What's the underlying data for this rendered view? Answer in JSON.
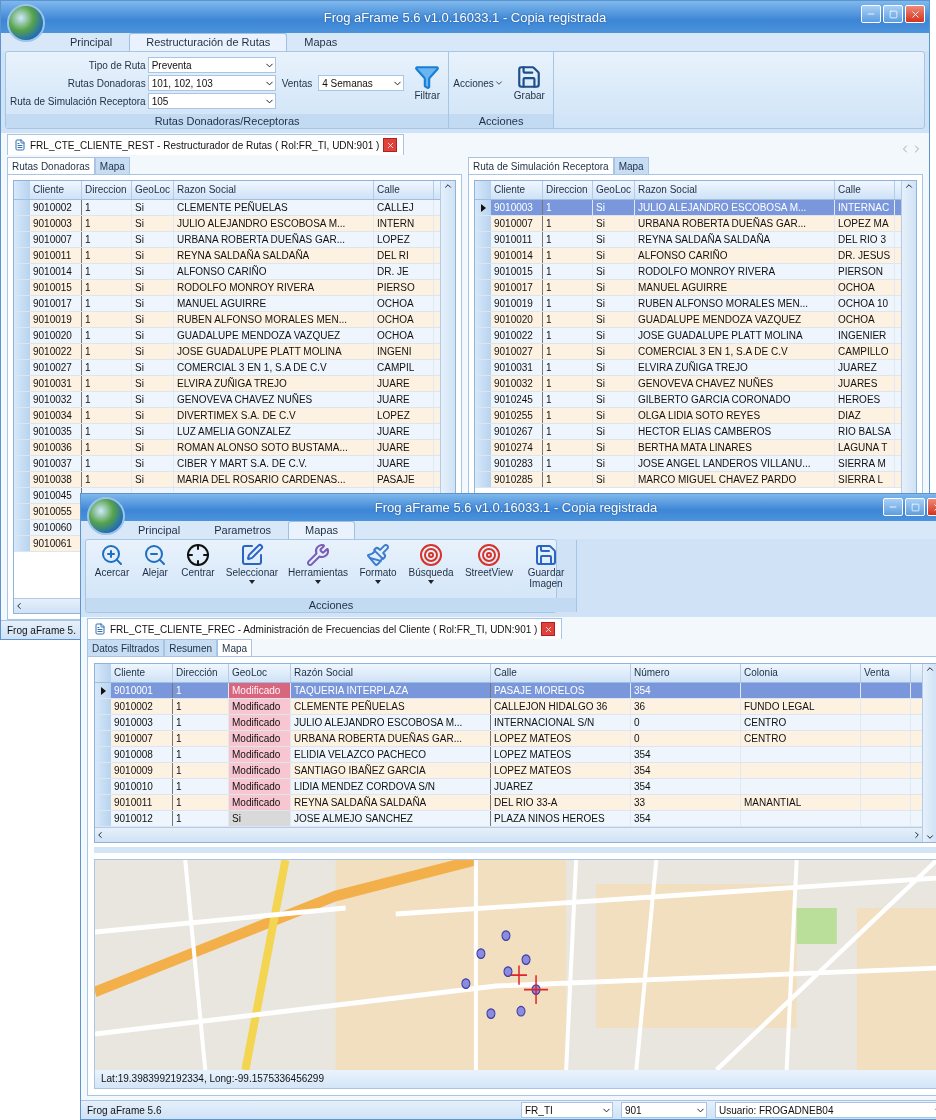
{
  "main_window": {
    "title": "Frog aFrame 5.6 v1.0.16033.1 - Copia registrada",
    "ribbon_tabs": [
      {
        "label": "Principal",
        "selected": false
      },
      {
        "label": "Restructuración de Rutas",
        "selected": true
      },
      {
        "label": "Mapas",
        "selected": false
      }
    ],
    "route_fields": [
      {
        "label": "Tipo de Ruta",
        "value": "Preventa"
      },
      {
        "label": "Rutas Donadoras",
        "value": "101, 102, 103"
      },
      {
        "label": "Ruta de Simulación Receptora",
        "value": "105"
      }
    ],
    "ventas": {
      "label": "Ventas",
      "value": "4 Semanas"
    },
    "filter_button": "Filtrar",
    "group_label": "Rutas Donadoras/Receptoras",
    "actions_menu": "Acciones",
    "save_button": "Grabar",
    "actions_group_label": "Acciones",
    "document_tab": "FRL_CTE_CLIENTE_REST - Restructurador de Rutas ( Rol:FR_TI, UDN:901 )",
    "panels": [
      {
        "tabs": [
          {
            "label": "Rutas Donadoras",
            "selected": true
          },
          {
            "label": "Mapa",
            "selected": false
          }
        ],
        "columns": [
          "Cliente",
          "Direccion",
          "GeoLoc",
          "Razon Social",
          "Calle"
        ],
        "rows": [
          {
            "cells": [
              "9010002",
              "1",
              "Si",
              "CLEMENTE PEÑUELAS",
              "CALLEJ"
            ],
            "selected": false
          },
          {
            "cells": [
              "9010003",
              "1",
              "Si",
              "JULIO ALEJANDRO ESCOBOSA M...",
              "INTERN"
            ],
            "selected": false
          },
          {
            "cells": [
              "9010007",
              "1",
              "Si",
              "URBANA ROBERTA DUEÑAS GAR...",
              "LOPEZ"
            ],
            "selected": false
          },
          {
            "cells": [
              "9010011",
              "1",
              "Si",
              "REYNA SALDAÑA SALDAÑA",
              "DEL RI"
            ],
            "selected": false
          },
          {
            "cells": [
              "9010014",
              "1",
              "Si",
              "ALFONSO CARIÑO",
              "DR. JE"
            ],
            "selected": false
          },
          {
            "cells": [
              "9010015",
              "1",
              "Si",
              "RODOLFO MONROY RIVERA",
              "PIERSO"
            ],
            "selected": false
          },
          {
            "cells": [
              "9010017",
              "1",
              "Si",
              "MANUEL AGUIRRE",
              "OCHOA"
            ],
            "selected": false
          },
          {
            "cells": [
              "9010019",
              "1",
              "Si",
              "RUBEN ALFONSO MORALES MEN...",
              "OCHOA"
            ],
            "selected": false
          },
          {
            "cells": [
              "9010020",
              "1",
              "Si",
              "GUADALUPE MENDOZA VAZQUEZ",
              "OCHOA"
            ],
            "selected": false
          },
          {
            "cells": [
              "9010022",
              "1",
              "Si",
              "JOSE GUADALUPE PLATT MOLINA",
              "INGENI"
            ],
            "selected": false
          },
          {
            "cells": [
              "9010027",
              "1",
              "Si",
              "COMERCIAL 3 EN 1, S.A DE C.V",
              "CAMPIL"
            ],
            "selected": false
          },
          {
            "cells": [
              "9010031",
              "1",
              "Si",
              "ELVIRA ZUÑIGA TREJO",
              "JUARE"
            ],
            "selected": false
          },
          {
            "cells": [
              "9010032",
              "1",
              "Si",
              "GENOVEVA CHAVEZ NUÑES",
              "JUARE"
            ],
            "selected": false
          },
          {
            "cells": [
              "9010034",
              "1",
              "Si",
              "DIVERTIMEX S.A. DE C.V",
              "LOPEZ"
            ],
            "selected": false
          },
          {
            "cells": [
              "9010035",
              "1",
              "Si",
              "LUZ AMELIA GONZALEZ",
              "JUARE"
            ],
            "selected": false
          },
          {
            "cells": [
              "9010036",
              "1",
              "Si",
              "ROMAN ALONSO SOTO BUSTAMA...",
              "JUARE"
            ],
            "selected": false
          },
          {
            "cells": [
              "9010037",
              "1",
              "Si",
              "CIBER Y MART S.A. DE C.V.",
              "JUARE"
            ],
            "selected": false
          },
          {
            "cells": [
              "9010038",
              "1",
              "Si",
              "MARIA DEL ROSARIO CARDENAS...",
              "PASAJE"
            ],
            "selected": false
          },
          {
            "cells": [
              "9010045"
            ],
            "selected": false
          },
          {
            "cells": [
              "9010055"
            ],
            "selected": false
          },
          {
            "cells": [
              "9010060"
            ],
            "selected": false
          },
          {
            "cells": [
              "9010061"
            ],
            "selected": false
          }
        ]
      },
      {
        "tabs": [
          {
            "label": "Ruta de Simulación Receptora",
            "selected": true
          },
          {
            "label": "Mapa",
            "selected": false
          }
        ],
        "columns": [
          "Cliente",
          "Direccion",
          "GeoLoc",
          "Razon Social",
          "Calle"
        ],
        "rows": [
          {
            "cells": [
              "9010003",
              "1",
              "Si",
              "JULIO ALEJANDRO ESCOBOSA M...",
              "INTERNAC"
            ],
            "selected": true
          },
          {
            "cells": [
              "9010007",
              "1",
              "Si",
              "URBANA ROBERTA DUEÑAS GAR...",
              "LOPEZ MA"
            ],
            "selected": false
          },
          {
            "cells": [
              "9010011",
              "1",
              "Si",
              "REYNA SALDAÑA SALDAÑA",
              "DEL RIO 3"
            ],
            "selected": false
          },
          {
            "cells": [
              "9010014",
              "1",
              "Si",
              "ALFONSO CARIÑO",
              "DR. JESUS"
            ],
            "selected": false
          },
          {
            "cells": [
              "9010015",
              "1",
              "Si",
              "RODOLFO MONROY RIVERA",
              "PIERSON"
            ],
            "selected": false
          },
          {
            "cells": [
              "9010017",
              "1",
              "Si",
              "MANUEL AGUIRRE",
              "OCHOA"
            ],
            "selected": false
          },
          {
            "cells": [
              "9010019",
              "1",
              "Si",
              "RUBEN ALFONSO MORALES MEN...",
              "OCHOA 10"
            ],
            "selected": false
          },
          {
            "cells": [
              "9010020",
              "1",
              "Si",
              "GUADALUPE MENDOZA VAZQUEZ",
              "OCHOA"
            ],
            "selected": false
          },
          {
            "cells": [
              "9010022",
              "1",
              "Si",
              "JOSE GUADALUPE PLATT MOLINA",
              "INGENIER"
            ],
            "selected": false
          },
          {
            "cells": [
              "9010027",
              "1",
              "Si",
              "COMERCIAL 3 EN 1, S.A DE C.V",
              "CAMPILLO"
            ],
            "selected": false
          },
          {
            "cells": [
              "9010031",
              "1",
              "Si",
              "ELVIRA ZUÑIGA TREJO",
              "JUAREZ"
            ],
            "selected": false
          },
          {
            "cells": [
              "9010032",
              "1",
              "Si",
              "GENOVEVA CHAVEZ NUÑES",
              "JUARES"
            ],
            "selected": false
          },
          {
            "cells": [
              "9010245",
              "1",
              "Si",
              "GILBERTO GARCIA CORONADO",
              "HEROES"
            ],
            "selected": false
          },
          {
            "cells": [
              "9010255",
              "1",
              "Si",
              "OLGA LIDIA SOTO REYES",
              "DIAZ"
            ],
            "selected": false
          },
          {
            "cells": [
              "9010267",
              "1",
              "Si",
              "HECTOR ELIAS CAMBEROS",
              "RIO BALSA"
            ],
            "selected": false
          },
          {
            "cells": [
              "9010274",
              "1",
              "Si",
              "BERTHA MATA LINARES",
              "LAGUNA T"
            ],
            "selected": false
          },
          {
            "cells": [
              "9010283",
              "1",
              "Si",
              "JOSE ANGEL LANDEROS VILLANU...",
              "SIERRA M"
            ],
            "selected": false
          },
          {
            "cells": [
              "9010285",
              "1",
              "Si",
              "MARCO MIGUEL CHAVEZ PARDO",
              "SIERRA L"
            ],
            "selected": false
          }
        ]
      }
    ],
    "status_bar": "Frog aFrame 5."
  },
  "map_window": {
    "title": "Frog aFrame 5.6 v1.0.16033.1 - Copia registrada",
    "ribbon_tabs": [
      {
        "label": "Principal",
        "selected": false
      },
      {
        "label": "Parametros",
        "selected": false
      },
      {
        "label": "Mapas",
        "selected": true
      }
    ],
    "tools": [
      {
        "label": "Acercar",
        "dropdown": false
      },
      {
        "label": "Alejar",
        "dropdown": false
      },
      {
        "label": "Centrar",
        "dropdown": false
      },
      {
        "label": "Seleccionar",
        "dropdown": true
      },
      {
        "label": "Herramientas",
        "dropdown": true
      },
      {
        "label": "Formato",
        "dropdown": true
      },
      {
        "label": "Búsqueda",
        "dropdown": true
      },
      {
        "label": "StreetView",
        "dropdown": false
      },
      {
        "label": "Guardar Imagen",
        "dropdown": false
      }
    ],
    "group_label": "Acciones",
    "document_tab": "FRL_CTE_CLIENTE_FREC - Administración de Frecuencias del Cliente ( Rol:FR_TI, UDN:901 )",
    "tabs": [
      {
        "label": "Datos Filtrados",
        "selected": false
      },
      {
        "label": "Resumen",
        "selected": false
      },
      {
        "label": "Mapa",
        "selected": true
      }
    ],
    "columns": [
      "Cliente",
      "Dirección",
      "GeoLoc",
      "Razón Social",
      "Calle",
      "Número",
      "Colonia",
      "Venta"
    ],
    "rows": [
      {
        "cells": [
          "9010001",
          "1",
          "Modificado",
          "TAQUERIA INTERPLAZA",
          "PASAJE MORELOS",
          "354"
        ],
        "selected": true,
        "modified": true
      },
      {
        "cells": [
          "9010002",
          "1",
          "Modificado",
          "CLEMENTE PEÑUELAS",
          "CALLEJON HIDALGO 36",
          "36",
          "FUNDO LEGAL"
        ],
        "selected": false,
        "modified": true
      },
      {
        "cells": [
          "9010003",
          "1",
          "Modificado",
          "JULIO ALEJANDRO ESCOBOSA M...",
          "INTERNACIONAL S/N",
          "0",
          "CENTRO"
        ],
        "selected": false,
        "modified": true
      },
      {
        "cells": [
          "9010007",
          "1",
          "Modificado",
          "URBANA ROBERTA DUEÑAS GAR...",
          "LOPEZ MATEOS",
          "0",
          "CENTRO"
        ],
        "selected": false,
        "modified": true
      },
      {
        "cells": [
          "9010008",
          "1",
          "Modificado",
          "ELIDIA VELAZCO PACHECO",
          "LOPEZ MATEOS",
          "354"
        ],
        "selected": false,
        "modified": true
      },
      {
        "cells": [
          "9010009",
          "1",
          "Modificado",
          "SANTIAGO IBAÑEZ GARCIA",
          "LOPEZ MATEOS",
          "354"
        ],
        "selected": false,
        "modified": true
      },
      {
        "cells": [
          "9010010",
          "1",
          "Modificado",
          "LIDIA MENDEZ CORDOVA S/N",
          "JUAREZ",
          "354"
        ],
        "selected": false,
        "modified": true
      },
      {
        "cells": [
          "9010011",
          "1",
          "Modificado",
          "REYNA SALDAÑA SALDAÑA",
          "DEL RIO 33-A",
          "33",
          "MANANTIAL"
        ],
        "selected": false,
        "modified": true
      },
      {
        "cells": [
          "9010012",
          "1",
          "Si",
          "JOSE ALMEJO SANCHEZ",
          "PLAZA NINOS HEROES",
          "354"
        ],
        "selected": false,
        "modified": false
      }
    ],
    "coordinates": "Lat:19.3983992192334, Long:-99.1575336456299",
    "status_bar": {
      "app": "Frog aFrame 5.6",
      "role": "FR_TI",
      "udn": "901",
      "user": "Usuario: FROGADNEB04"
    }
  }
}
